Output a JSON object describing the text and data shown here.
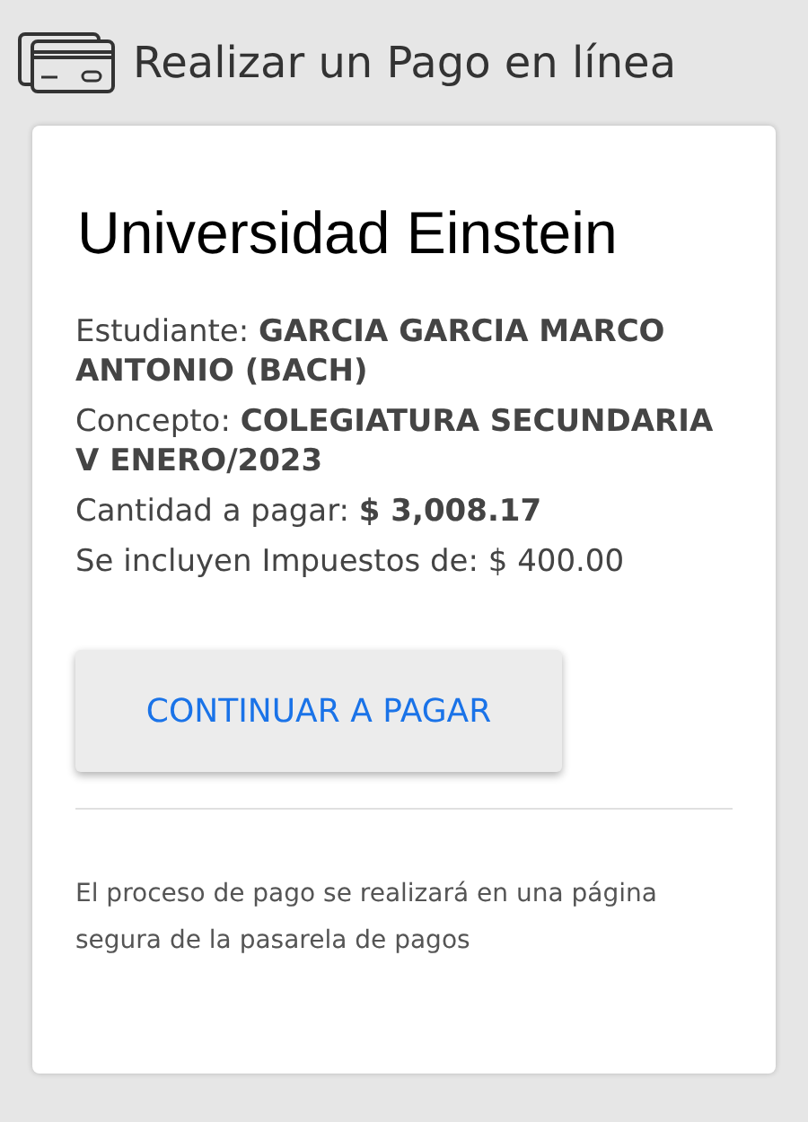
{
  "header": {
    "title": "Realizar un Pago en línea"
  },
  "card": {
    "institution": "Universidad Einstein",
    "details": [
      "Estudiante: **GARCIA GARCIA MARCO ANTONIO (BACH)**",
      "Concepto: **COLEGIATURA SECUNDARIA V ENERO/2023**",
      "Cantidad a pagar: **$ 3,008.17**",
      "Se incluyen Impuestos de: $ 400.00"
    ],
    "button": "CONTINUAR A PAGAR",
    "note": "El proceso de pago se realizará en una página segura de la pasarela de pagos"
  }
}
